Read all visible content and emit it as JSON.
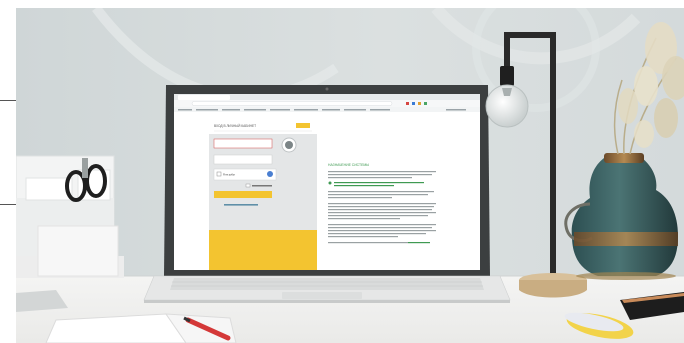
{
  "photo": {
    "subject": "laptop-on-desk",
    "colors": {
      "wall": "#d6dcdc",
      "desk": "#f2f2f1",
      "accent_yellow": "#f3c430",
      "link_green": "#3f9a52",
      "vase_teal": "#3a6565"
    }
  },
  "browser": {
    "address": "",
    "tabs": [
      ""
    ]
  },
  "screen": {
    "login_panel": {
      "title": "ВХОД В ЛИЧНЫЙ КАБИНЕТ",
      "fields": [
        ""
      ],
      "captcha_label": "Я не робот",
      "submit_label": "",
      "help_link": ""
    },
    "info_panel": {
      "heading": "НАЗНАЧЕНИЕ СИСТЕМЫ",
      "paragraphs": [
        "",
        "",
        "",
        ""
      ]
    }
  }
}
